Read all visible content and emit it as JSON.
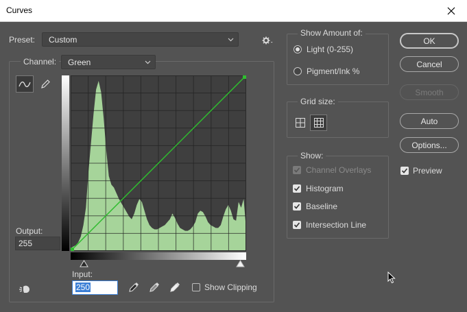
{
  "window": {
    "title": "Curves"
  },
  "preset": {
    "label": "Preset:",
    "value": "Custom"
  },
  "channel": {
    "label": "Channel:",
    "value": "Green"
  },
  "output": {
    "label": "Output:",
    "value": "255"
  },
  "input": {
    "label": "Input:",
    "value": "250"
  },
  "show_clipping": {
    "label": "Show Clipping",
    "checked": false
  },
  "show_amount": {
    "title": "Show Amount of:",
    "options": [
      {
        "label": "Light  (0-255)",
        "selected": true
      },
      {
        "label": "Pigment/Ink %",
        "selected": false
      }
    ]
  },
  "grid_size": {
    "title": "Grid size:"
  },
  "show": {
    "title": "Show:",
    "items": [
      {
        "label": "Channel Overlays",
        "checked": true,
        "disabled": true
      },
      {
        "label": "Histogram",
        "checked": true,
        "disabled": false
      },
      {
        "label": "Baseline",
        "checked": true,
        "disabled": false
      },
      {
        "label": "Intersection Line",
        "checked": true,
        "disabled": false
      }
    ]
  },
  "buttons": {
    "ok": "OK",
    "cancel": "Cancel",
    "smooth": "Smooth",
    "auto": "Auto",
    "options": "Options..."
  },
  "preview": {
    "label": "Preview",
    "checked": true
  },
  "colors": {
    "curve": "#2fbf2f",
    "histogram": "#a6d49a",
    "graph_bg": "#3f3f3f"
  },
  "curve": {
    "points": [
      {
        "input": 0,
        "output": 0
      },
      {
        "input": 255,
        "output": 255
      }
    ],
    "histogram": [
      2,
      3,
      4,
      6,
      10,
      18,
      30,
      55,
      75,
      95,
      112,
      118,
      110,
      92,
      70,
      52,
      46,
      44,
      40,
      36,
      33,
      30,
      27,
      24,
      22,
      26,
      32,
      36,
      34,
      28,
      22,
      18,
      16,
      15,
      15,
      16,
      17,
      18,
      20,
      22,
      26,
      23,
      19,
      16,
      15,
      14,
      14,
      15,
      17,
      20,
      26,
      28,
      27,
      24,
      20,
      18,
      17,
      16,
      16,
      18,
      24,
      29,
      32,
      28,
      22,
      21,
      34,
      30,
      36,
      15
    ]
  }
}
